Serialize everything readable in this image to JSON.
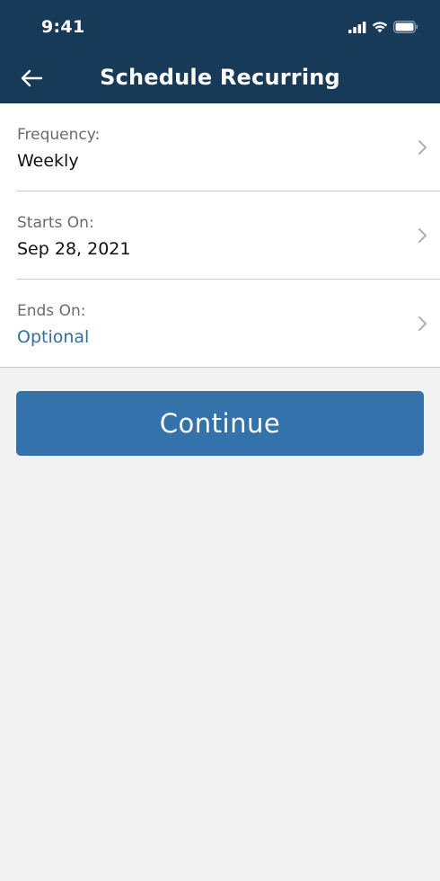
{
  "status_bar": {
    "time": "9:41"
  },
  "nav": {
    "title": "Schedule Recurring",
    "back_icon": "arrow-left-icon"
  },
  "fields": [
    {
      "label": "Frequency:",
      "value": "Weekly",
      "is_placeholder": false
    },
    {
      "label": "Starts On:",
      "value": "Sep 28, 2021",
      "is_placeholder": false
    },
    {
      "label": "Ends On:",
      "value": "Optional",
      "is_placeholder": true
    }
  ],
  "actions": {
    "continue_label": "Continue"
  },
  "colors": {
    "header_bg": "#163a58",
    "accent": "#3472ab",
    "placeholder_text": "#2f6fa8",
    "page_bg": "#f2f2f2"
  }
}
